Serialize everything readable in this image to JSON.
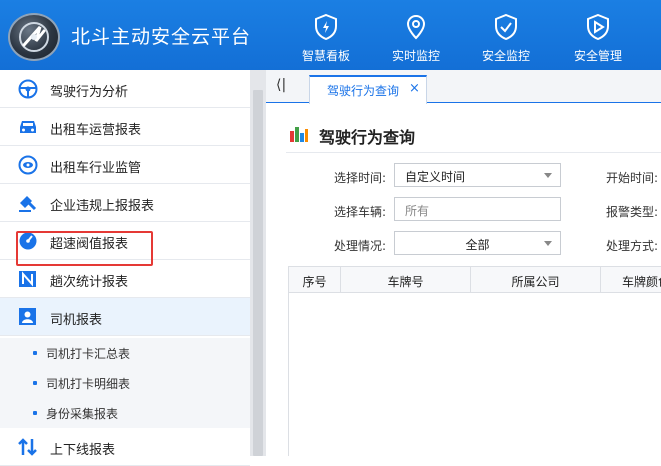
{
  "header": {
    "app_title": "北斗主动安全云平台",
    "nav": [
      {
        "label": "智慧看板",
        "icon": "shield-flash-icon"
      },
      {
        "label": "实时监控",
        "icon": "location-pin-icon"
      },
      {
        "label": "安全监控",
        "icon": "shield-check-icon"
      },
      {
        "label": "安全管理",
        "icon": "shield-play-icon"
      }
    ],
    "brand_color": "#1776de"
  },
  "sidebar": {
    "items": [
      {
        "label": "驾驶行为分析",
        "icon": "steering-wheel-icon"
      },
      {
        "label": "出租车运营报表",
        "icon": "car-icon"
      },
      {
        "label": "出租车行业监管",
        "icon": "eye-icon"
      },
      {
        "label": "企业违规上报报表",
        "icon": "gavel-icon"
      },
      {
        "label": "超速阀值报表",
        "icon": "speedometer-icon"
      },
      {
        "label": "趟次统计报表",
        "icon": "chart-n-icon"
      },
      {
        "label": "司机报表",
        "icon": "user-icon",
        "active": true
      },
      {
        "label": "上下线报表",
        "icon": "up-down-arrows-icon"
      }
    ],
    "sub_items": [
      {
        "label": "司机打卡汇总表"
      },
      {
        "label": "司机打卡明细表"
      },
      {
        "label": "身份采集报表"
      }
    ],
    "highlight_color": "#e53935"
  },
  "tabs": {
    "collapse_glyph": "⟨|",
    "items": [
      {
        "label": "驾驶行为查询",
        "close": "×"
      }
    ]
  },
  "page": {
    "title": "驾驶行为查询",
    "form": {
      "time_label": "选择时间:",
      "time_value": "自定义时间",
      "start_label": "开始时间:",
      "vehicle_label": "选择车辆:",
      "vehicle_placeholder": "所有",
      "alarm_type_label": "报警类型:",
      "status_label": "处理情况:",
      "status_value": "全部",
      "method_label": "处理方式:"
    },
    "table": {
      "columns": [
        "序号",
        "车牌号",
        "所属公司",
        "车牌颜色"
      ]
    }
  }
}
